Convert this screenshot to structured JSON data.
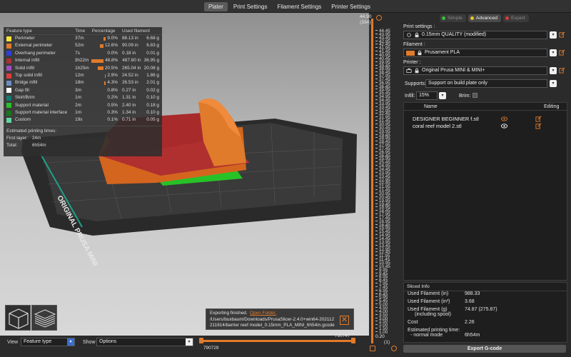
{
  "tabs": [
    "Plater",
    "Print Settings",
    "Filament Settings",
    "Printer Settings"
  ],
  "legend": {
    "headers": [
      "Feature type",
      "Time",
      "Percentage",
      "Used filament"
    ],
    "rows": [
      {
        "name": "Perimeter",
        "time": "37m",
        "pct": "9.0%",
        "pct_value": 9.0,
        "length": "88.13 in",
        "weight": "6.68 g",
        "color": "#f5e53a"
      },
      {
        "name": "External perimeter",
        "time": "52m",
        "pct": "12.6%",
        "pct_value": 12.6,
        "length": "90.09 in",
        "weight": "6.83 g",
        "color": "#e07b2b"
      },
      {
        "name": "Overhang perimeter",
        "time": "7s",
        "pct": "0.0%",
        "pct_value": 0.0,
        "length": "0.18 in",
        "weight": "0.01 g",
        "color": "#2b3fd9"
      },
      {
        "name": "Internal infill",
        "time": "3h22m",
        "pct": "48.8%",
        "pct_value": 48.8,
        "length": "487.80 in",
        "weight": "36.95 g",
        "color": "#b03030"
      },
      {
        "name": "Solid infill",
        "time": "1h25m",
        "pct": "20.5%",
        "pct_value": 20.5,
        "length": "265.04 in",
        "weight": "20.08 g",
        "color": "#9b4fc0"
      },
      {
        "name": "Top solid infill",
        "time": "12m",
        "pct": "2.9%",
        "pct_value": 2.9,
        "length": "24.52 in",
        "weight": "1.86 g",
        "color": "#e03c3c"
      },
      {
        "name": "Bridge infill",
        "time": "18m",
        "pct": "4.3%",
        "pct_value": 4.3,
        "length": "26.53 in",
        "weight": "2.01 g",
        "color": "#6b8fc4"
      },
      {
        "name": "Gap fill",
        "time": "3m",
        "pct": "0.8%",
        "pct_value": 0.8,
        "length": "0.27 in",
        "weight": "0.02 g",
        "color": "#ffffff"
      },
      {
        "name": "Skirt/Brim",
        "time": "1m",
        "pct": "0.2%",
        "pct_value": 0.2,
        "length": "1.31 in",
        "weight": "0.10 g",
        "color": "#147a6e"
      },
      {
        "name": "Support material",
        "time": "2m",
        "pct": "0.5%",
        "pct_value": 0.5,
        "length": "2.40 in",
        "weight": "0.18 g",
        "color": "#27c227"
      },
      {
        "name": "Support material interface",
        "time": "1m",
        "pct": "0.3%",
        "pct_value": 0.3,
        "length": "1.34 in",
        "weight": "0.10 g",
        "color": "#157a1c"
      },
      {
        "name": "Custom",
        "time": "19s",
        "pct": "0.1%",
        "pct_value": 0.1,
        "length": "0.71 in",
        "weight": "0.05 g",
        "color": "#5ed6a0"
      }
    ],
    "est_title": "Estimated printing times:",
    "first_layer_label": "First layer:",
    "first_layer_value": "24m",
    "total_label": "Total:",
    "total_value": "6h54m"
  },
  "export_note": {
    "line1": "Exporting finished.",
    "link": "Open Folder.",
    "line2": "/Users/buxbaum/Downloads/PrusaSlicer-2.4.0+win64-202112",
    "line3": "211614/barrier reef model_0.15mm_PLA_MINI_6h54m.gcode"
  },
  "bottombar": {
    "view_label": "View",
    "view_value": "Feature type",
    "show_label": "Show",
    "show_value": "Options"
  },
  "hslider": {
    "left_value": "790729",
    "right_value": "790747"
  },
  "vslider": {
    "top_value": "44.90",
    "top_layer": "(334)",
    "bottom_value": "0.20",
    "bottom_layer": "(1)",
    "ticks": [
      "44.45",
      "43.95",
      "43.45",
      "42.95",
      "42.45",
      "41.95",
      "41.45",
      "40.95",
      "40.45",
      "39.95",
      "39.45",
      "38.95",
      "38.45",
      "37.95",
      "37.45",
      "36.95",
      "36.45",
      "35.95",
      "35.45",
      "34.95",
      "34.45",
      "33.95",
      "33.45",
      "32.95",
      "32.45",
      "31.95",
      "31.45",
      "30.95",
      "30.45",
      "29.95",
      "29.45",
      "28.95",
      "28.45",
      "27.95",
      "27.45",
      "26.95",
      "26.45",
      "25.95",
      "25.45",
      "24.95",
      "24.45",
      "23.95",
      "23.45",
      "22.95",
      "22.45",
      "21.95",
      "21.45",
      "20.95",
      "20.45",
      "19.95",
      "19.45",
      "18.95",
      "18.45",
      "17.95",
      "17.45",
      "16.95",
      "16.45",
      "15.95",
      "15.45",
      "14.95",
      "14.45",
      "13.95",
      "13.45",
      "12.95",
      "12.45",
      "11.95",
      "11.45",
      "10.95",
      "10.45",
      "9.95",
      "9.45",
      "8.95",
      "8.45",
      "7.95",
      "7.45",
      "6.95",
      "6.45",
      "5.95",
      "5.45",
      "5.00",
      "4.50",
      "4.00",
      "3.50",
      "3.00",
      "2.50",
      "2.00",
      "1.50",
      "1.00"
    ]
  },
  "sidebar": {
    "modes": [
      {
        "label": "Simple",
        "dot": "#3cbf3c",
        "active": false
      },
      {
        "label": "Advanced",
        "dot": "#e6c42a",
        "active": true
      },
      {
        "label": "Expert",
        "dot": "#d63c3c",
        "active": false
      }
    ],
    "print_settings_label": "Print settings :",
    "print_settings_value": "0.15mm QUALITY (modified)",
    "filament_label": "Filament :",
    "filament_value": "Prusament PLA",
    "filament_color": "#e07b2b",
    "printer_label": "Printer :",
    "printer_value": "Original Prusa MINI & MINI+",
    "supports_label": "Supports:",
    "supports_value": "Support on build plate only",
    "infill_label": "Infill:",
    "infill_value": "15%",
    "brim_label": "Brim:",
    "list_name_header": "Name",
    "list_editing_header": "Editing",
    "objects": [
      "DESIGNER BEGINNER f.stl",
      "coral reef model 2.stl"
    ],
    "sliced_title": "Sliced Info",
    "sliced_rows": [
      {
        "label": "Used Filament (in)",
        "value": "988.33"
      },
      {
        "label": "Used Filament (in³)",
        "value": "3.68"
      },
      {
        "label": "Used Filament (g)",
        "sub": "(including spool)",
        "value": "74.87 (275.87)"
      },
      {
        "label": "Cost",
        "value": "2.26"
      },
      {
        "label": "Estimated printing time:",
        "sub": "- normal mode",
        "value": "6h54m"
      }
    ],
    "export_button": "Export G-code"
  },
  "bed_label": "ORIGINAL PRUSA MINI"
}
